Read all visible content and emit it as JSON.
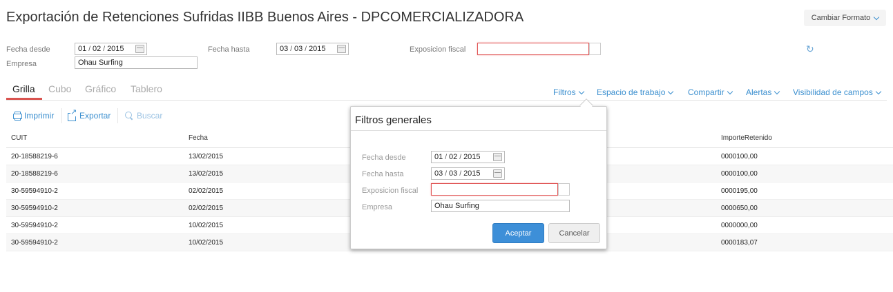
{
  "header": {
    "title": "Exportación de Retenciones Sufridas IIBB Buenos Aires - DPCOMERCIALIZADORA",
    "format_button": "Cambiar Formato"
  },
  "filters": {
    "fecha_desde_label": "Fecha desde",
    "fecha_desde": {
      "day": "01",
      "month": "02",
      "year": "2015"
    },
    "fecha_hasta_label": "Fecha hasta",
    "fecha_hasta": {
      "day": "03",
      "month": "03",
      "year": "2015"
    },
    "exposicion_label": "Exposicion fiscal",
    "exposicion_value": "",
    "empresa_label": "Empresa",
    "empresa_value": "Ohau Surfing"
  },
  "tabs": [
    {
      "label": "Grilla",
      "active": true
    },
    {
      "label": "Cubo",
      "active": false
    },
    {
      "label": "Gráfico",
      "active": false
    },
    {
      "label": "Tablero",
      "active": false
    }
  ],
  "menus": [
    "Filtros",
    "Espacio de trabajo",
    "Compartir",
    "Alertas",
    "Visibilidad de campos"
  ],
  "toolbar": {
    "print": "Imprimir",
    "export": "Exportar",
    "search": "Buscar"
  },
  "grid": {
    "columns": [
      "CUIT",
      "Fecha",
      "ImporteRetenido"
    ],
    "rows": [
      [
        "20-18588219-6",
        "13/02/2015",
        "0000100,00"
      ],
      [
        "20-18588219-6",
        "13/02/2015",
        "0000100,00"
      ],
      [
        "30-59594910-2",
        "02/02/2015",
        "0000195,00"
      ],
      [
        "30-59594910-2",
        "02/02/2015",
        "0000650,00"
      ],
      [
        "30-59594910-2",
        "10/02/2015",
        "0000000,00"
      ],
      [
        "30-59594910-2",
        "10/02/2015",
        "0000183,07"
      ]
    ]
  },
  "popup": {
    "title": "Filtros generales",
    "fecha_desde_label": "Fecha desde",
    "fecha_desde": {
      "day": "01",
      "month": "02",
      "year": "2015"
    },
    "fecha_hasta_label": "Fecha hasta",
    "fecha_hasta": {
      "day": "03",
      "month": "03",
      "year": "2015"
    },
    "exposicion_label": "Exposicion fiscal",
    "exposicion_value": "",
    "empresa_label": "Empresa",
    "empresa_value": "Ohau Surfing",
    "accept": "Aceptar",
    "cancel": "Cancelar"
  },
  "colors": {
    "accent": "#3b8fcf",
    "active_tab": "#d9534f",
    "error_border": "#e05555",
    "primary_button": "#3d8fd8"
  }
}
